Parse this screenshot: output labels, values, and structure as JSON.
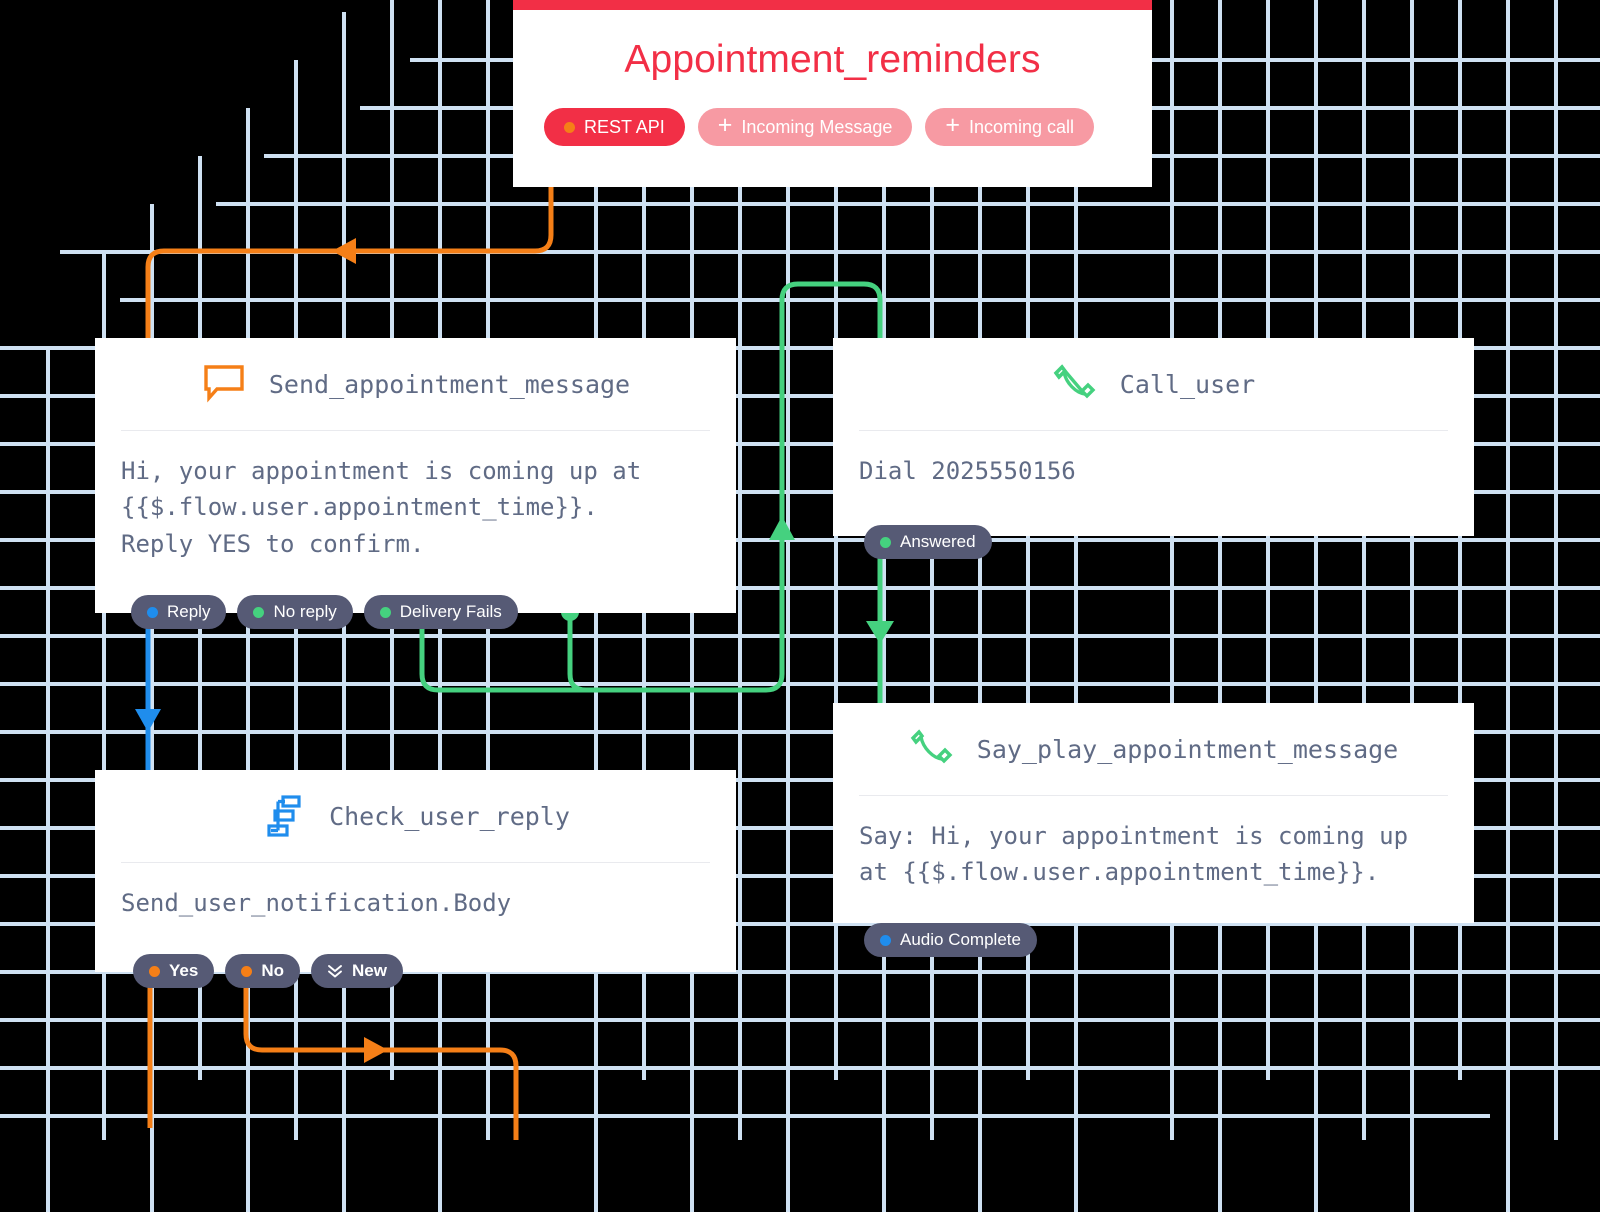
{
  "colors": {
    "background": "#000000",
    "grid_line": "#cfe1f2",
    "card_bg": "#ffffff",
    "brand_red": "#f22f46",
    "brand_red_light": "#f79aa3",
    "orange": "#f57f17",
    "green": "#45d17f",
    "blue": "#1f8ded",
    "pill_bg": "#565a75",
    "text_muted": "#606b85"
  },
  "trigger": {
    "title": "Appointment_reminders",
    "pills": [
      {
        "label": "REST API",
        "state": "active",
        "icon": "dot-icon"
      },
      {
        "label": "Incoming Message",
        "state": "inactive",
        "icon": "plus-icon"
      },
      {
        "label": "Incoming call",
        "state": "inactive",
        "icon": "plus-icon"
      }
    ]
  },
  "nodes": [
    {
      "id": "send-appointment-message",
      "title": "Send_appointment_message",
      "icon": "chat-bubble-icon",
      "icon_color": "#f57f17",
      "body": "Hi, your appointment is coming up at\n{{$.flow.user.appointment_time}}.\nReply YES to confirm.",
      "outputs": [
        {
          "label": "Reply",
          "dot": "#1f8ded"
        },
        {
          "label": "No reply",
          "dot": "#45d17f"
        },
        {
          "label": "Delivery Fails",
          "dot": "#45d17f"
        }
      ]
    },
    {
      "id": "call-user",
      "title": "Call_user",
      "icon": "phone-icon",
      "icon_color": "#45d17f",
      "body": "Dial 2025550156",
      "outputs": [
        {
          "label": "Answered",
          "dot": "#45d17f"
        }
      ]
    },
    {
      "id": "check-user-reply",
      "title": "Check_user_reply",
      "icon": "split-branch-icon",
      "icon_color": "#1f8ded",
      "body": "Send_user_notification.Body",
      "outputs": [
        {
          "label": "Yes",
          "dot": "#f57f17",
          "bold": true
        },
        {
          "label": "No",
          "dot": "#f57f17",
          "bold": true
        },
        {
          "label": "New",
          "icon": "double-chevron-down-icon",
          "bold": true
        }
      ]
    },
    {
      "id": "say-play-appointment-message",
      "title": "Say_play_appointment_message",
      "icon": "phone-icon",
      "icon_color": "#45d17f",
      "body": "Say: Hi, your appointment is coming up\nat {{$.flow.user.appointment_time}}.",
      "outputs": [
        {
          "label": "Audio Complete",
          "dot": "#1f8ded"
        }
      ]
    }
  ]
}
